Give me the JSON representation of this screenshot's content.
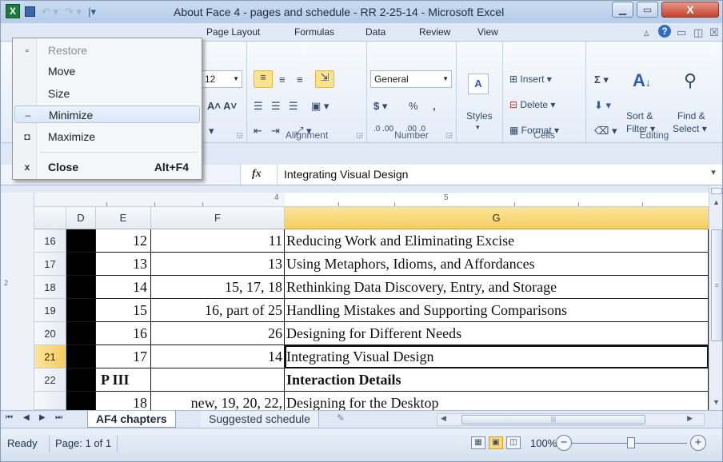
{
  "window": {
    "title": "About Face 4 - pages and schedule - RR 2-25-14  -  Microsoft Excel",
    "app_icon": "excel-icon",
    "buttons": {
      "minimize": "minimize-icon",
      "maximize": "maximize-icon",
      "close": "X"
    }
  },
  "ribbon": {
    "tabs": [
      "Page Layout",
      "Formulas",
      "Data",
      "Review",
      "View"
    ],
    "font": {
      "size": "12"
    },
    "alignment": {
      "label": "Alignment"
    },
    "number": {
      "format": "General",
      "label": "Number",
      "currency": "$",
      "percent": "%",
      "comma": ",",
      "inc_decimal": ".0 .00",
      "dec_decimal": ".00 .0"
    },
    "styles": {
      "label": "Styles"
    },
    "cells": {
      "insert": "Insert",
      "delete": "Delete",
      "format": "Format",
      "label": "Cells"
    },
    "editing": {
      "sum": "Σ",
      "sort": "Sort &",
      "filter": "Filter",
      "find": "Find &",
      "select": "Select",
      "label": "Editing"
    }
  },
  "formula_bar": {
    "fx": "fx",
    "value": "Integrating Visual Design"
  },
  "ruler": {
    "marks": [
      "4",
      "5"
    ],
    "left_marks": [
      "2"
    ]
  },
  "columns": [
    "D",
    "E",
    "F",
    "G"
  ],
  "selected_column": "G",
  "rows": [
    {
      "num": "16",
      "e": "12",
      "f": "11",
      "g": "Reducing Work and Eliminating Excise"
    },
    {
      "num": "17",
      "e": "13",
      "f": "13",
      "g": "Using Metaphors, Idioms, and Affordances"
    },
    {
      "num": "18",
      "e": "14",
      "f": "15, 17, 18",
      "g": "Rethinking Data Discovery, Entry, and Storage"
    },
    {
      "num": "19",
      "e": "15",
      "f": "16, part of 25",
      "g": "Handling Mistakes and Supporting Comparisons"
    },
    {
      "num": "20",
      "e": "16",
      "f": "26",
      "g": "Designing for Different Needs"
    },
    {
      "num": "21",
      "e": "17",
      "f": "14",
      "g": "Integrating Visual Design"
    },
    {
      "num": "22",
      "e": "P III",
      "f": "",
      "g": "Interaction Details"
    },
    {
      "num": "",
      "e": "18",
      "f": "new, 19, 20, 22,",
      "g": "Designing for the Desktop"
    }
  ],
  "selected_row": "21",
  "sheets": {
    "active": "AF4 chapters",
    "other": "Suggested schedule"
  },
  "status": {
    "ready": "Ready",
    "page": "Page: 1 of 1",
    "zoom": "100%"
  },
  "system_menu": {
    "items": [
      {
        "label": "Restore",
        "icon": "restore-icon",
        "glyph": "▫",
        "disabled": true
      },
      {
        "label": "Move",
        "icon": "",
        "glyph": "",
        "disabled": false
      },
      {
        "label": "Size",
        "icon": "",
        "glyph": "",
        "disabled": false
      },
      {
        "label": "Minimize",
        "icon": "minimize-icon",
        "glyph": "–",
        "disabled": false
      },
      {
        "label": "Maximize",
        "icon": "maximize-icon",
        "glyph": "◘",
        "disabled": false
      },
      {
        "label": "Close",
        "icon": "close-icon",
        "glyph": "x",
        "shortcut": "Alt+F4"
      }
    ]
  }
}
